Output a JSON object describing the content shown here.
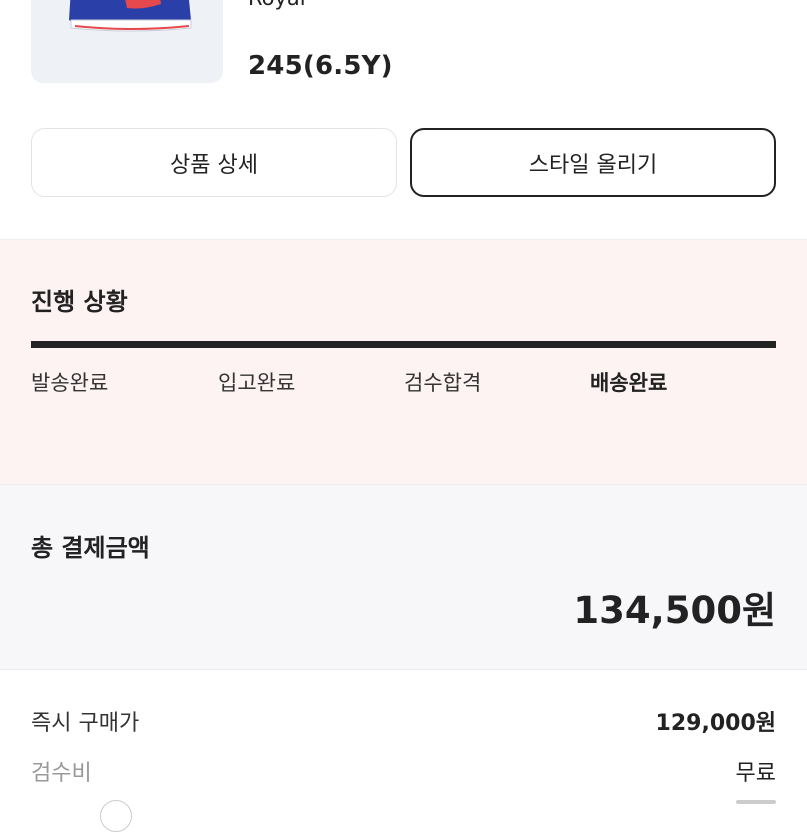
{
  "product": {
    "name": "Royal",
    "size": "245(6.5Y)",
    "image_icon": "sneaker-image"
  },
  "actions": {
    "detail_label": "상품 상세",
    "style_label": "스타일 올리기"
  },
  "progress": {
    "title": "진행 상황",
    "steps": [
      {
        "label": "발송완료"
      },
      {
        "label": "입고완료"
      },
      {
        "label": "검수합격"
      },
      {
        "label": "배송완료"
      }
    ],
    "current_step": 4,
    "progress_fraction": 1.0
  },
  "total": {
    "title": "총 결제금액",
    "amount": "134,500원"
  },
  "breakdown": [
    {
      "label": "즉시 구매가",
      "value": "129,000원"
    },
    {
      "label": "검수비",
      "value": "무료"
    }
  ],
  "colors": {
    "accent": "#222222",
    "progress_bg": "#fdf3f3",
    "total_bg": "#f7f6f9",
    "shoe_blue": "#2b3fa8",
    "shoe_red": "#e5484d"
  }
}
